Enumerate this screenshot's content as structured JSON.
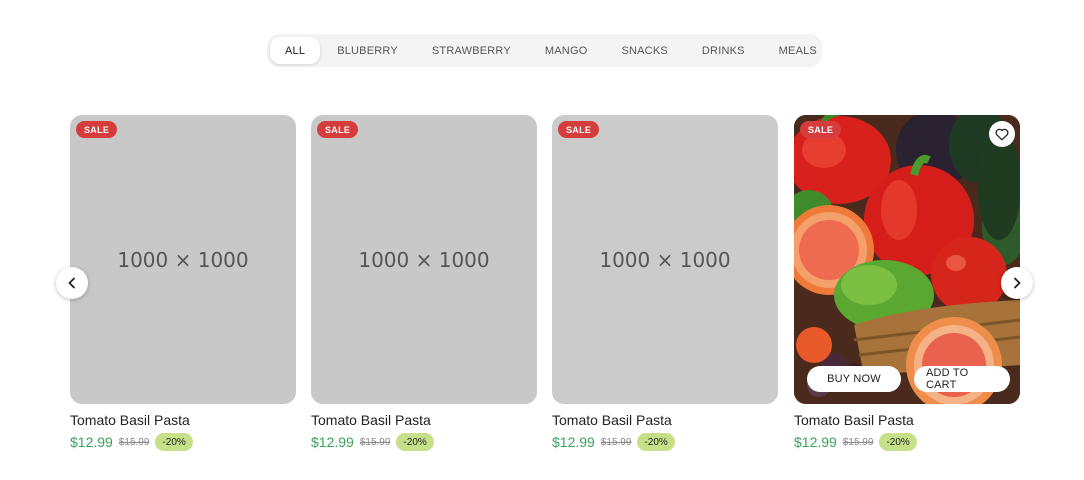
{
  "tabs": [
    {
      "label": "ALL",
      "active": true
    },
    {
      "label": "BLUBERRY"
    },
    {
      "label": "STRAWBERRY"
    },
    {
      "label": "MANGO"
    },
    {
      "label": "SNACKS"
    },
    {
      "label": "DRINKS"
    },
    {
      "label": "MEALS"
    }
  ],
  "icons": {
    "prev": "chevron-left-icon",
    "next": "chevron-right-icon",
    "wishlist": "heart-icon"
  },
  "colors": {
    "sale_badge": "#d63c3c",
    "price": "#3aa35b",
    "discount_badge": "#c6e08a"
  },
  "products": [
    {
      "badge": "SALE",
      "placeholder": "1000 × 1000",
      "name": "Tomato Basil Pasta",
      "price": "$12.99",
      "old_price": "$15.99",
      "discount": "-20%"
    },
    {
      "badge": "SALE",
      "placeholder": "1000 × 1000",
      "name": "Tomato Basil Pasta",
      "price": "$12.99",
      "old_price": "$15.99",
      "discount": "-20%"
    },
    {
      "badge": "SALE",
      "placeholder": "1000 × 1000",
      "name": "Tomato Basil Pasta",
      "price": "$12.99",
      "old_price": "$15.99",
      "discount": "-20%"
    },
    {
      "badge": "SALE",
      "image": "vegetables",
      "name": "Tomato Basil Pasta",
      "price": "$12.99",
      "old_price": "$15.99",
      "discount": "-20%",
      "buy_label": "BUY NOW",
      "cart_label": "ADD TO CART"
    }
  ]
}
